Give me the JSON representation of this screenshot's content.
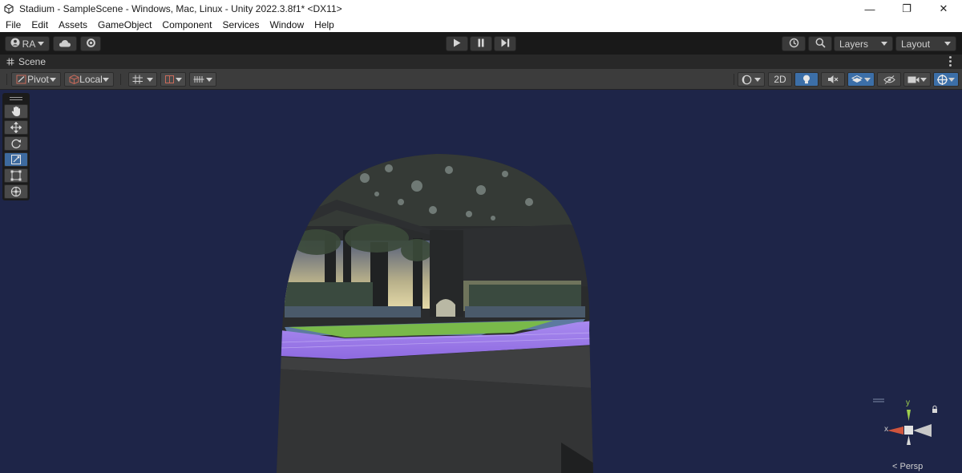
{
  "window": {
    "title": "Stadium - SampleScene - Windows, Mac, Linux - Unity 2022.3.8f1* <DX11>",
    "controls": {
      "minimize": "—",
      "restore": "❐",
      "close": "✕"
    }
  },
  "menu": [
    "File",
    "Edit",
    "Assets",
    "GameObject",
    "Component",
    "Services",
    "Window",
    "Help"
  ],
  "toolbar": {
    "account": "RA",
    "layers": "Layers",
    "layout": "Layout"
  },
  "scene_tab": {
    "label": "Scene"
  },
  "scene_toolbar": {
    "pivot": "Pivot",
    "local": "Local",
    "mode_2d": "2D"
  },
  "gizmo": {
    "x_label": "x",
    "y_label": "y",
    "projection": "< Persp"
  },
  "colors": {
    "sky": "#1e2548",
    "grass": "#7bc043",
    "track": "#9b74e8",
    "tunnel": "#3e3f40",
    "accent": "#3d6a9e"
  }
}
